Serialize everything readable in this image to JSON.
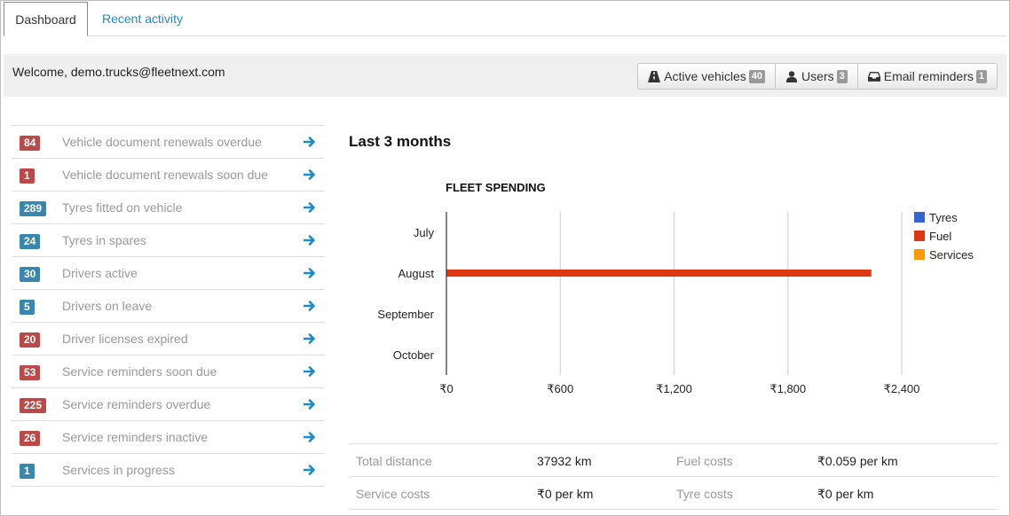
{
  "tabs": [
    {
      "label": "Dashboard",
      "active": true
    },
    {
      "label": "Recent activity",
      "active": false
    }
  ],
  "welcome": {
    "text": "Welcome, demo.trucks@fleetnext.com",
    "buttons": [
      {
        "label": "Active vehicles",
        "count": "40",
        "icon": "road-icon"
      },
      {
        "label": "Users",
        "count": "3",
        "icon": "user-icon"
      },
      {
        "label": "Email reminders",
        "count": "1",
        "icon": "inbox-icon"
      }
    ]
  },
  "alerts": [
    {
      "count": "84",
      "label": "Vehicle document renewals overdue",
      "color": "red"
    },
    {
      "count": "1",
      "label": "Vehicle document renewals soon due",
      "color": "red"
    },
    {
      "count": "289",
      "label": "Tyres fitted on vehicle",
      "color": "blue"
    },
    {
      "count": "24",
      "label": "Tyres in spares",
      "color": "blue"
    },
    {
      "count": "30",
      "label": "Drivers active",
      "color": "blue"
    },
    {
      "count": "5",
      "label": "Drivers on leave",
      "color": "blue"
    },
    {
      "count": "20",
      "label": "Driver licenses expired",
      "color": "red"
    },
    {
      "count": "53",
      "label": "Service reminders soon due",
      "color": "red"
    },
    {
      "count": "225",
      "label": "Service reminders overdue",
      "color": "red"
    },
    {
      "count": "26",
      "label": "Service reminders inactive",
      "color": "red"
    },
    {
      "count": "1",
      "label": "Services in progress",
      "color": "blue"
    }
  ],
  "section_title": "Last 3 months",
  "chart_data": {
    "type": "bar",
    "orientation": "horizontal",
    "title": "FLEET SPENDING",
    "categories": [
      "July",
      "August",
      "September",
      "October"
    ],
    "series": [
      {
        "name": "Tyres",
        "color": "#3366cc",
        "values": [
          0,
          0,
          0,
          0
        ]
      },
      {
        "name": "Fuel",
        "color": "#dc3912",
        "values": [
          0,
          2240,
          0,
          0
        ]
      },
      {
        "name": "Services",
        "color": "#ff9900",
        "values": [
          0,
          0,
          0,
          0
        ]
      }
    ],
    "xticks": [
      "₹0",
      "₹600",
      "₹1,200",
      "₹1,800",
      "₹2,400"
    ],
    "xlim": [
      0,
      2400
    ],
    "grid": true,
    "legend": "right"
  },
  "stats": [
    {
      "label1": "Total distance",
      "value1": "37932 km",
      "label2": "Fuel costs",
      "value2": "₹0.059 per km"
    },
    {
      "label1": "Service costs",
      "value1": "₹0 per km",
      "label2": "Tyre costs",
      "value2": "₹0 per km"
    }
  ]
}
